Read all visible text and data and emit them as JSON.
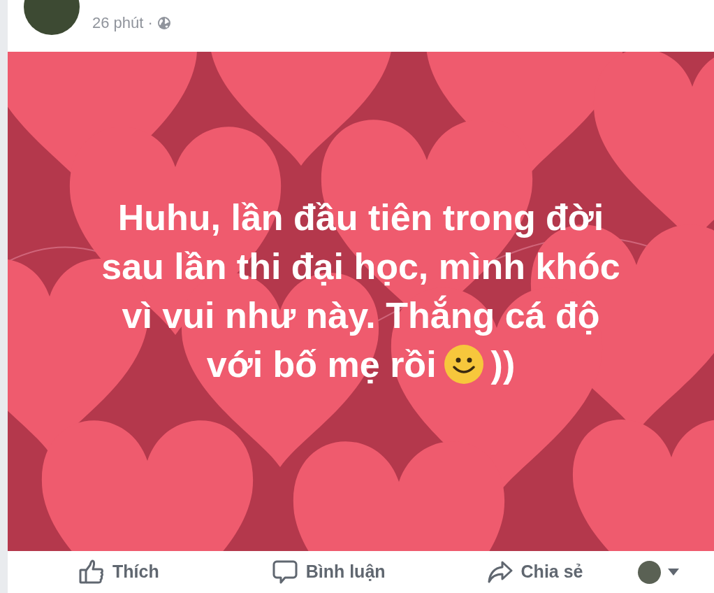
{
  "post": {
    "time": "26 phút",
    "separator": "·",
    "text_lines": [
      "Huhu, lần đầu tiên trong đời",
      "sau lần thi đại học, mình khóc",
      "vì vui như này. Thắng cá độ",
      "với bố mẹ rồi"
    ],
    "text_suffix": "))",
    "actions": [
      {
        "kind": "like",
        "label": "Thích"
      },
      {
        "kind": "comment",
        "label": "Bình luận"
      },
      {
        "kind": "share",
        "label": "Chia sẻ"
      }
    ]
  }
}
